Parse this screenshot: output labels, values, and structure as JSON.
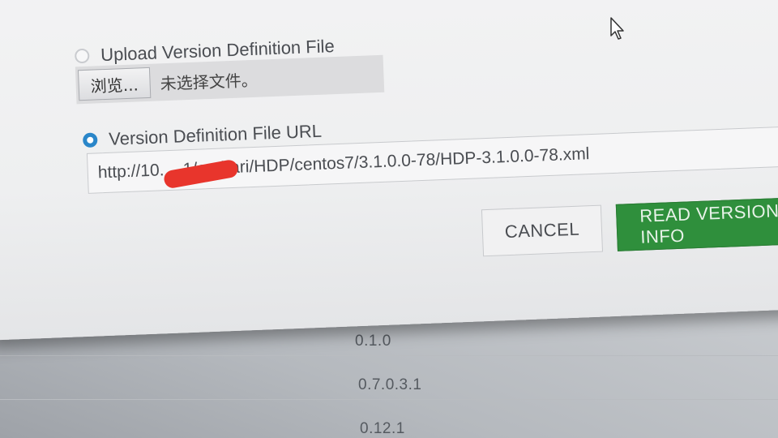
{
  "background_list": {
    "items": [
      "0.1.0",
      "0.7.0.3.1",
      "0.12.1"
    ]
  },
  "dialog": {
    "upload_option": {
      "label": "Upload Version Definition File",
      "selected": false
    },
    "file_picker": {
      "browse_label": "浏览...",
      "status": "未选择文件。"
    },
    "url_option": {
      "label": "Version Definition File URL",
      "selected": true
    },
    "url_input": {
      "value": "http://10.   .  .1/ambari/HDP/centos7/3.1.0.0-78/HDP-3.1.0.0-78.xml"
    },
    "buttons": {
      "cancel": "CANCEL",
      "read_version_info": "READ VERSION INFO"
    }
  },
  "colors": {
    "accent_blue": "#2a86c9",
    "primary_green": "#2f8f3c",
    "redaction": "#e8352c"
  }
}
